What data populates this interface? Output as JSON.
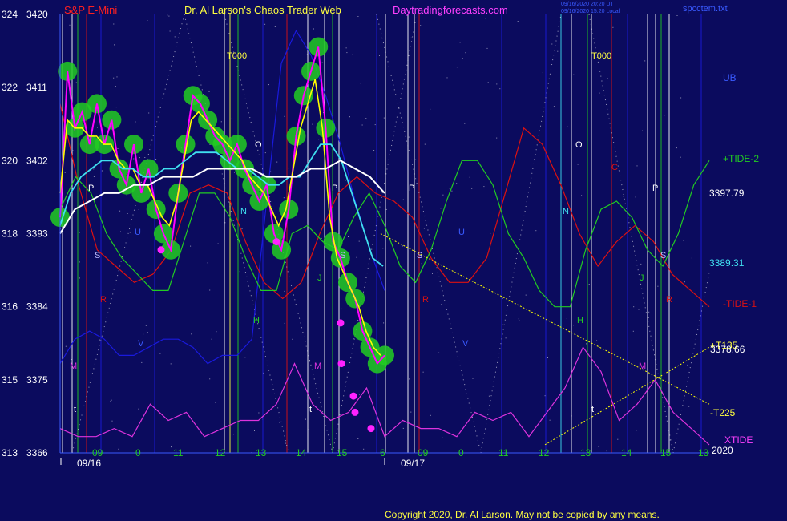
{
  "header": {
    "instrument": "S&P E-Mini",
    "title": "Dr. Al Larson's Chaos Trader Web",
    "site": "Daytradingforecasts.com",
    "stamp1": "09/16/2020 20:20 UT",
    "stamp2": "09/16/2020 15:20 Local",
    "file": "spcctem.txt"
  },
  "colors": {
    "background": "#0b0b5e",
    "price_bars": "#ff00ff",
    "highlight": "#22cc22",
    "fast_ma": "#ffff00",
    "mid_ma": "#40e0f0",
    "slow_ma": "#ffffff",
    "tide_pos": "#22cc22",
    "tide_neg": "#dd1111",
    "ub": "#1a1add",
    "xtide": "#dd33dd",
    "forecast_lines": "#ffff00"
  },
  "footer": {
    "copyright": "Copyright 2020, Dr. Al Larson. May not be copied by any means."
  },
  "chart_data": {
    "type": "line",
    "y_axis": {
      "range": [
        3366,
        3420
      ],
      "left_labels": [
        "324",
        "322",
        "320",
        "318",
        "316",
        "315",
        "313"
      ],
      "right_labels": [
        "3420",
        "3411",
        "3402",
        "3393",
        "3384",
        "3375",
        "3366"
      ]
    },
    "x_axis": {
      "hour_labels": [
        "09",
        "0",
        "11",
        "12",
        "13",
        "14",
        "15",
        "6",
        "09",
        "0",
        "11",
        "12",
        "13",
        "14",
        "15",
        "13"
      ],
      "date_labels": [
        "09/16",
        "09/17"
      ],
      "year_label": "2020"
    },
    "right_labels": {
      "ub": "UB",
      "tide2": "+TIDE-2",
      "v1": "3397.79",
      "v2": "3389.31",
      "tide1": "-TIDE-1",
      "t135": "+T135",
      "v3": "3378.66",
      "t225": "-T225",
      "xtide": "XTIDE"
    },
    "markers": [
      "T000",
      "T000",
      "P",
      "O",
      "P",
      "P",
      "O",
      "C",
      "P",
      "S",
      "S",
      "S",
      "S",
      "R",
      "R",
      "R",
      "N",
      "N",
      "J",
      "J",
      "H",
      "H",
      "U",
      "U",
      "V",
      "V",
      "M",
      "M",
      "M",
      "t",
      "t",
      "t"
    ],
    "series": [
      {
        "name": "S&P E-Mini",
        "values": [
          3395,
          3413,
          3406,
          3408,
          3404,
          3409,
          3404,
          3407,
          3401,
          3399,
          3404,
          3398,
          3401,
          3396,
          3393,
          3391,
          3398,
          3404,
          3410,
          3409,
          3407,
          3405,
          3404,
          3402,
          3404,
          3401,
          3399,
          3397,
          3399,
          3393,
          3391,
          3396,
          3405,
          3410,
          3413,
          3416,
          3406,
          3392,
          3390,
          3387,
          3385,
          3381,
          3379,
          3377,
          3378
        ]
      },
      {
        "name": "fast",
        "values": [
          3398,
          3407,
          3406,
          3406,
          3405,
          3405,
          3404,
          3404,
          3402,
          3401,
          3401,
          3399,
          3399,
          3397,
          3395,
          3394,
          3397,
          3402,
          3407,
          3408,
          3407,
          3406,
          3405,
          3404,
          3403,
          3402,
          3400,
          3399,
          3398,
          3396,
          3394,
          3396,
          3401,
          3406,
          3409,
          3412,
          3406,
          3395,
          3390,
          3388,
          3386,
          3384,
          3381,
          3379,
          3378
        ]
      },
      {
        "name": "mid",
        "values": [
          3394,
          3398,
          3400,
          3401,
          3402,
          3402,
          3401,
          3401,
          3400,
          3400,
          3401,
          3401,
          3402,
          3403,
          3403,
          3403,
          3402,
          3401,
          3401,
          3400,
          3399,
          3399,
          3400,
          3400,
          3402,
          3404,
          3404,
          3402,
          3398,
          3394,
          3390,
          3389
        ]
      },
      {
        "name": "slow",
        "values": [
          3393,
          3396,
          3397,
          3398,
          3398,
          3399,
          3399,
          3400,
          3400,
          3400,
          3401,
          3401,
          3401,
          3401,
          3400,
          3400,
          3400,
          3401,
          3401,
          3402,
          3401,
          3400,
          3398
        ]
      },
      {
        "name": "+TIDE-2",
        "values": [
          3396,
          3400,
          3398,
          3393,
          3390,
          3388,
          3386,
          3386,
          3392,
          3398,
          3398,
          3395,
          3390,
          3386,
          3386,
          3393,
          3394,
          3392,
          3391,
          3395,
          3398,
          3394,
          3389,
          3387,
          3391,
          3397,
          3402,
          3402,
          3399,
          3393,
          3390,
          3386,
          3384,
          3384,
          3391,
          3396,
          3397,
          3395,
          3391,
          3389,
          3393,
          3399,
          3402
        ]
      },
      {
        "name": "-TIDE-1",
        "values": [
          3409,
          3399,
          3391,
          3389,
          3387,
          3388,
          3391,
          3398,
          3399,
          3398,
          3392,
          3387,
          3385,
          3387,
          3393,
          3398,
          3400,
          3398,
          3397,
          3395,
          3390,
          3387,
          3387,
          3390,
          3398,
          3406,
          3404,
          3399,
          3393,
          3389,
          3392,
          3394,
          3392,
          3388,
          3386,
          3384
        ]
      },
      {
        "name": "UB",
        "values": [
          3377,
          3380,
          3381,
          3380,
          3378,
          3378,
          3379,
          3380,
          3380,
          3379,
          3377,
          3378,
          3378,
          3380,
          3397,
          3414,
          3418,
          3415,
          3410,
          3404,
          3397,
          3391,
          3386
        ]
      },
      {
        "name": "XTIDE",
        "values": [
          3369,
          3368,
          3368,
          3369,
          3368,
          3372,
          3370,
          3371,
          3368,
          3369,
          3370,
          3370,
          3372,
          3377,
          3372,
          3370,
          3371,
          3374,
          3368,
          3370,
          3369,
          3369,
          3368,
          3371,
          3370,
          3371,
          3368,
          3371,
          3374,
          3379,
          3376,
          3370,
          3372,
          3375,
          3371,
          3369,
          3367
        ]
      }
    ]
  }
}
